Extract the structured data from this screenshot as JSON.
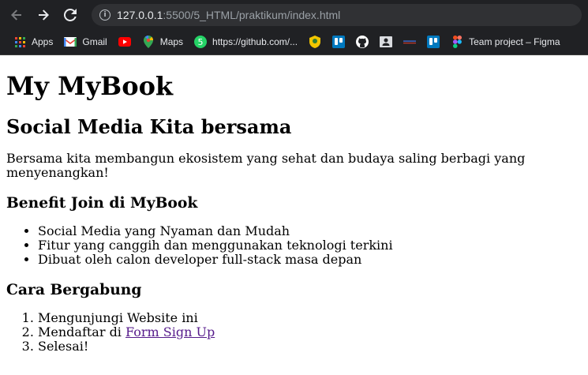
{
  "browser": {
    "url_host": "127.0.0.1",
    "url_path": ":5500/5_HTML/praktikum/index.html",
    "bookmarks": [
      {
        "label": "Apps",
        "icon": "apps-icon"
      },
      {
        "label": "Gmail",
        "icon": "gmail-icon"
      },
      {
        "label": "",
        "icon": "youtube-icon"
      },
      {
        "label": "Maps",
        "icon": "maps-icon"
      },
      {
        "label": "https://github.com/...",
        "icon": "whatsapp-icon"
      },
      {
        "label": "",
        "icon": "emblem-icon"
      },
      {
        "label": "",
        "icon": "trello-icon"
      },
      {
        "label": "",
        "icon": "github-icon"
      },
      {
        "label": "",
        "icon": "contact-card-icon"
      },
      {
        "label": "",
        "icon": "bar-icon"
      },
      {
        "label": "",
        "icon": "trello-icon-2"
      },
      {
        "label": "Team project – Figma",
        "icon": "figma-icon"
      }
    ],
    "colors": {
      "chrome_bg": "#202124",
      "omnibox_bg": "#303134",
      "link_visited": "#551a8b"
    }
  },
  "page": {
    "title": "My MyBook",
    "subtitle": "Social Media Kita bersama",
    "intro": "Bersama kita membangun ekosistem yang sehat dan budaya saling berbagi yang menyenangkan!",
    "benefit_heading": "Benefit Join di MyBook",
    "benefits": [
      "Social Media yang Nyaman dan Mudah",
      "Fitur yang canggih dan menggunakan teknologi terkini",
      "Dibuat oleh calon developer full-stack masa depan"
    ],
    "join_heading": "Cara Bergabung",
    "steps": {
      "step1": "Mengunjungi Website ini",
      "step2_prefix": "Mendaftar di ",
      "step2_link": "Form Sign Up",
      "step3": "Selesai!"
    }
  }
}
